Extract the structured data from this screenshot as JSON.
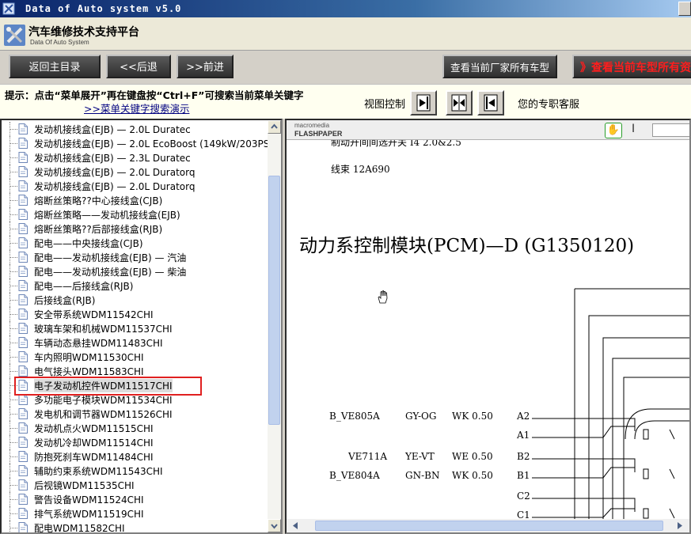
{
  "window": {
    "title": "Data of Auto system v5.0"
  },
  "header": {
    "app_name": "汽车维修技术支持平台",
    "app_subname": "Data Of Auto System"
  },
  "nav": {
    "back_main": "返回主目录",
    "back": "<<后退",
    "forward": ">>前进",
    "all_models": "查看当前厂家所有车型",
    "current_model": "》查看当前车型所有资"
  },
  "tips": {
    "line1": "提示：点击“菜单展开”再在键盘按“Ctrl+F”可搜索当前菜单关键字",
    "line2": ">>菜单关键字搜索演示",
    "view_control": "视图控制",
    "support": "您的专职客服"
  },
  "tree": {
    "items": [
      "发动机接线盒(EJB) — 2.0L Duratec",
      "发动机接线盒(EJB) — 2.0L EcoBoost (149kW/203PS",
      "发动机接线盒(EJB) — 2.3L Duratec",
      "发动机接线盒(EJB) — 2.0L Duratorq",
      "发动机接线盒(EJB) — 2.0L Duratorq",
      "熔断丝策略??中心接线盒(CJB)",
      "熔断丝策略——发动机接线盒(EJB)",
      "熔断丝策略??后部接线盒(RJB)",
      "配电——中央接线盒(CJB)",
      "配电——发动机接线盒(EJB) — 汽油",
      "配电——发动机接线盒(EJB) — 柴油",
      "配电——后接线盒(RJB)",
      "后接线盒(RJB)",
      "安全带系统WDM11542CHI",
      "玻璃车架和机械WDM11537CHI",
      "车辆动态悬挂WDM11483CHI",
      "车内照明WDM11530CHI",
      "电气接头WDM11583CHI",
      "电子发动机控件WDM11517CHI",
      "多功能电子模块WDM11534CHI",
      "发电机和调节器WDM11526CHI",
      "发动机点火WDM11515CHI",
      "发动机冷却WDM11514CHI",
      "防抱死刹车WDM11484CHI",
      "辅助约束系统WDM11543CHI",
      "后视镜WDM11535CHI",
      "警告设备WDM11524CHI",
      "排气系统WDM11519CHI",
      "配电WDM11582CHI"
    ],
    "selected_index": 18
  },
  "viewer": {
    "brand_line1": "macromedia",
    "brand_line2": "FLASHPAPER",
    "doc": {
      "top_partial": "制动开间间选开关  I4 2.0&2.5",
      "harness": "线束 12A690",
      "module_title": "动力系控制模块(PCM)—D (G1350120)",
      "signals": [
        {
          "name": "B_VE805A",
          "color": "GY-OG",
          "wire": "WK 0.50",
          "pin": "A2"
        },
        {
          "name": "",
          "color": "",
          "wire": "",
          "pin": "A1"
        },
        {
          "name": "VE711A",
          "color": "YE-VT",
          "wire": "WE 0.50",
          "pin": "B2"
        },
        {
          "name": "B_VE804A",
          "color": "GN-BN",
          "wire": "WK 0.50",
          "pin": "B1"
        },
        {
          "name": "",
          "color": "",
          "wire": "",
          "pin": "C2"
        },
        {
          "name": "",
          "color": "",
          "wire": "",
          "pin": "C1"
        }
      ]
    }
  },
  "colors": {
    "title_bar": "#0a246a",
    "nav_button": "#3f3f3f",
    "highlight_red": "#e02020",
    "nav_red_text": "#ff1d1d"
  }
}
